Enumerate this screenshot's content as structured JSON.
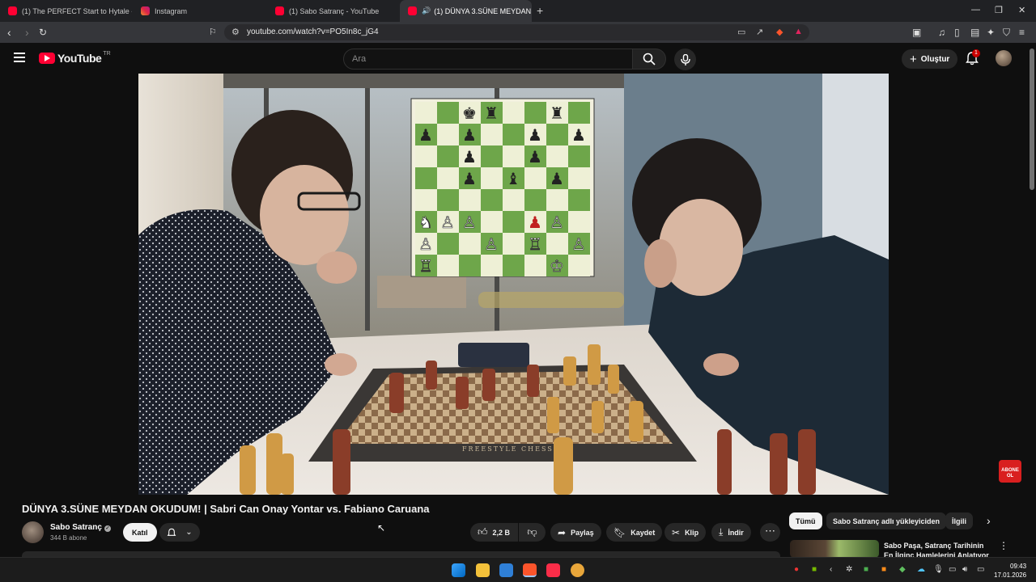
{
  "browser": {
    "tabs": [
      {
        "label": "(1) The PERFECT Start to Hytale - You",
        "favicon_color": "#ff0033"
      },
      {
        "label": "Instagram",
        "favicon_color": "#d6249f"
      },
      {
        "label": "(1) Sabo Satranç - YouTube",
        "favicon_color": "#ff0033"
      },
      {
        "label": "(1) DÜNYA 3.SÜNE MEYDAN",
        "favicon_color": "#ff0033",
        "active": true
      }
    ],
    "url": "youtube.com/watch?v=PO5In8c_jG4"
  },
  "youtube": {
    "logo_text": "YouTube",
    "country_code": "TR",
    "search_placeholder": "Ara",
    "create_label": "Oluştur",
    "notification_count": "1"
  },
  "video": {
    "title": "DÜNYA 3.SÜNE MEYDAN OKUDUM! | Sabri Can Onay Yontar vs. Fabiano Caruana",
    "board_brand": "FREESTYLE CHESS"
  },
  "channel": {
    "name": "Sabo Satranç",
    "subscribers": "344 B abone",
    "join_label": "Katıl"
  },
  "actions": {
    "likes": "2,2 B",
    "share": "Paylaş",
    "save": "Kaydet",
    "clip": "Klip",
    "download": "İndir"
  },
  "sidebar": {
    "chips": [
      "Tümü",
      "Sabo Satranç adlı yükleyiciden",
      "İlgili"
    ],
    "rec_title": "Sabo Paşa, Satranç Tarihinin En İlginç Hamlelerini Anlatıyor"
  },
  "overlay": {
    "subscribe_line1": "ABONE",
    "subscribe_line2": "OL"
  },
  "system": {
    "time": "09:43",
    "date": "17.01.2026"
  }
}
